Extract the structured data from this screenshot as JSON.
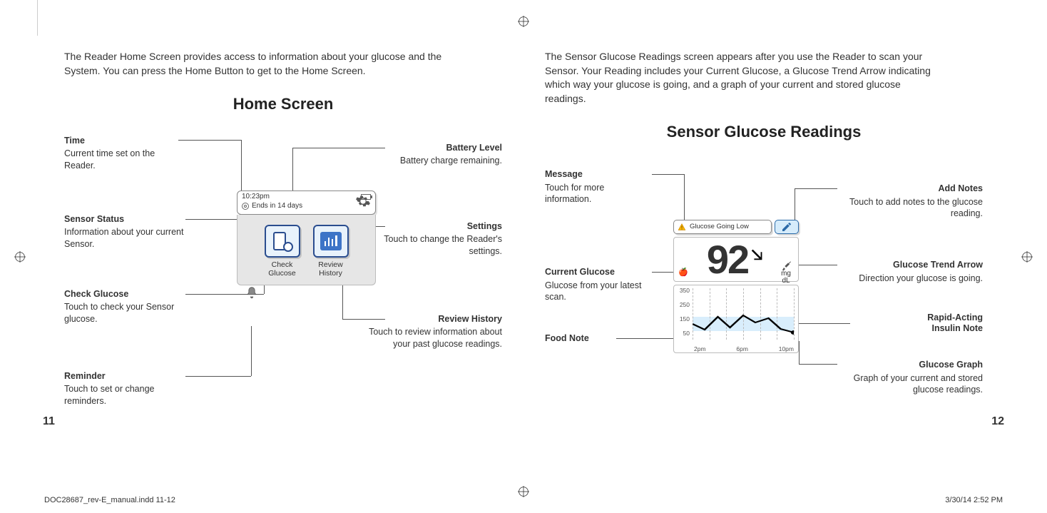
{
  "footer": {
    "file": "DOC28687_rev-E_manual.indd   11-12",
    "datetime": "3/30/14   2:52 PM"
  },
  "page_left_num": "11",
  "page_right_num": "12",
  "left": {
    "intro": "The Reader Home Screen provides access to information about your glucose and the System. You can press the Home Button to get to the Home Screen.",
    "title": "Home Screen",
    "callouts": {
      "time": {
        "t": "Time",
        "d": "Current time set on the Reader."
      },
      "sensor": {
        "t": "Sensor Status",
        "d": "Information about your current Sensor."
      },
      "check": {
        "t": "Check Glucose",
        "d": "Touch to check your Sensor glucose."
      },
      "reminder": {
        "t": "Reminder",
        "d": "Touch to set or change reminders."
      },
      "battery": {
        "t": "Battery Level",
        "d": "Battery charge remaining."
      },
      "settings": {
        "t": "Settings",
        "d": "Touch to change the Reader's settings."
      },
      "history": {
        "t": "Review History",
        "d": "Touch to review information about your past glucose readings."
      }
    },
    "device": {
      "clock": "10:23pm",
      "sensor_line": "Ends in 14 days",
      "tile_check": "Check\nGlucose",
      "tile_history": "Review\nHistory"
    }
  },
  "right": {
    "intro": "The Sensor Glucose Readings screen appears after you use the Reader to scan your Sensor. Your Reading includes your Current Glucose, a Glucose Trend Arrow indicating which way your glucose is going, and a graph of your current and stored glucose readings.",
    "title": "Sensor Glucose Readings",
    "callouts": {
      "message": {
        "t": "Message",
        "d": "Touch for more information."
      },
      "current": {
        "t": "Current Glucose",
        "d": "Glucose from your latest scan."
      },
      "food": {
        "t": "Food Note",
        "d": ""
      },
      "notes": {
        "t": "Add Notes",
        "d": "Touch to add notes to the glucose reading."
      },
      "trend": {
        "t": "Glucose Trend Arrow",
        "d": "Direction your glucose is going."
      },
      "insulin": {
        "t": "Rapid-Acting Insulin Note",
        "d": ""
      },
      "graph": {
        "t": "Glucose Graph",
        "d": "Graph of your current and stored glucose readings."
      }
    },
    "device": {
      "message": "Glucose Going Low",
      "value": "92",
      "units": "mg\ndL",
      "ylabels": [
        "350",
        "250",
        "150",
        "50"
      ],
      "xlabels": [
        "2pm",
        "6pm",
        "10pm"
      ]
    }
  },
  "chart_data": {
    "type": "line",
    "title": "Glucose Graph",
    "xlabel": "",
    "ylabel": "mg/dL",
    "ylim": [
      50,
      350
    ],
    "x": [
      "2pm",
      "3pm",
      "4pm",
      "5pm",
      "6pm",
      "7pm",
      "8pm",
      "9pm",
      "10pm"
    ],
    "values": [
      140,
      110,
      170,
      120,
      175,
      145,
      170,
      115,
      92
    ],
    "target_band": [
      80,
      150
    ],
    "x_ticks": [
      "2pm",
      "6pm",
      "10pm"
    ],
    "y_ticks": [
      50,
      150,
      250,
      350
    ]
  }
}
